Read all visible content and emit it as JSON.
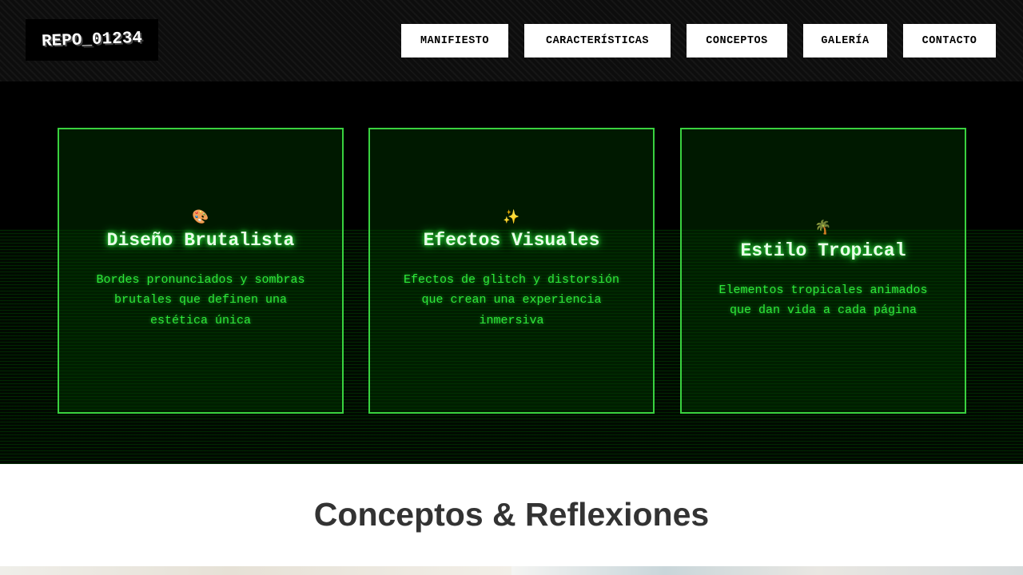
{
  "header": {
    "logo": "REPO_01234",
    "nav": [
      {
        "label": "MANIFIESTO"
      },
      {
        "label": "CARACTERÍSTICAS"
      },
      {
        "label": "CONCEPTOS"
      },
      {
        "label": "GALERÍA"
      },
      {
        "label": "CONTACTO"
      }
    ]
  },
  "features": [
    {
      "icon": "🎨",
      "icon_name": "palette-icon",
      "title": "Diseño Brutalista",
      "description": "Bordes pronunciados y sombras brutales que definen una estética única"
    },
    {
      "icon": "✨",
      "icon_name": "sparkles-icon",
      "title": "Efectos Visuales",
      "description": "Efectos de glitch y distorsión que crean una experiencia inmersiva"
    },
    {
      "icon": "🌴",
      "icon_name": "palm-tree-icon",
      "title": "Estilo Tropical",
      "description": "Elementos tropicales animados que dan vida a cada página"
    }
  ],
  "concepts": {
    "title": "Conceptos & Reflexiones"
  },
  "colors": {
    "accent_green": "#39d13f",
    "background": "#000000",
    "nav_button": "#ffffff"
  }
}
